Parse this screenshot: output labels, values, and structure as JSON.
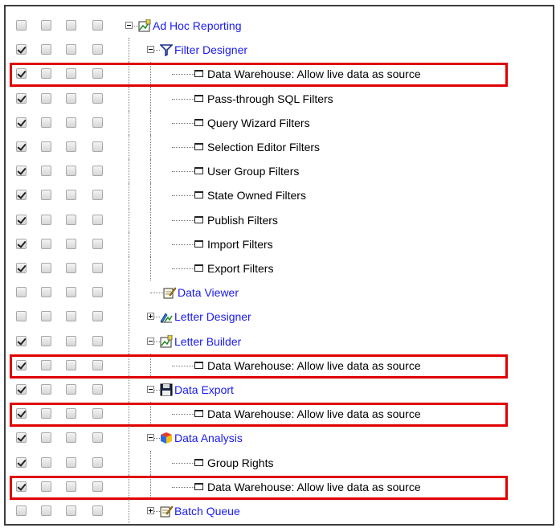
{
  "tree": {
    "rows": [
      {
        "label": "Ad Hoc Reporting",
        "checked": false,
        "level": 0,
        "expander": "minus",
        "icon": "ad-hoc-report-icon",
        "link": true
      },
      {
        "label": "Filter Designer",
        "checked": true,
        "level": 1,
        "expander": "minus",
        "icon": "filter-funnel-icon",
        "link": true
      },
      {
        "label": "Data Warehouse: Allow live data as source",
        "checked": true,
        "level": 2,
        "icon": "leaf-right-icon",
        "link": false,
        "highlighted": true
      },
      {
        "label": "Pass-through SQL Filters",
        "checked": true,
        "level": 2,
        "icon": "leaf-right-icon",
        "link": false
      },
      {
        "label": "Query Wizard Filters",
        "checked": true,
        "level": 2,
        "icon": "leaf-right-icon",
        "link": false
      },
      {
        "label": "Selection Editor Filters",
        "checked": true,
        "level": 2,
        "icon": "leaf-right-icon",
        "link": false
      },
      {
        "label": "User Group Filters",
        "checked": true,
        "level": 2,
        "icon": "leaf-right-icon",
        "link": false
      },
      {
        "label": "State Owned Filters",
        "checked": true,
        "level": 2,
        "icon": "leaf-right-icon",
        "link": false
      },
      {
        "label": "Publish Filters",
        "checked": true,
        "level": 2,
        "icon": "leaf-right-icon",
        "link": false
      },
      {
        "label": "Import Filters",
        "checked": true,
        "level": 2,
        "icon": "leaf-right-icon",
        "link": false
      },
      {
        "label": "Export Filters",
        "checked": true,
        "level": 2,
        "icon": "leaf-right-icon",
        "link": false
      },
      {
        "label": "Data Viewer",
        "checked": false,
        "level": 1,
        "icon": "data-viewer-notepad-icon",
        "link": true
      },
      {
        "label": "Letter Designer",
        "checked": false,
        "level": 1,
        "expander": "plus",
        "icon": "letter-designer-icon",
        "link": true
      },
      {
        "label": "Letter Builder",
        "checked": true,
        "level": 1,
        "expander": "minus",
        "icon": "letter-builder-icon",
        "link": true
      },
      {
        "label": "Data Warehouse: Allow live data as source",
        "checked": true,
        "level": 2,
        "icon": "leaf-right-icon",
        "link": false,
        "highlighted": true
      },
      {
        "label": "Data Export",
        "checked": true,
        "level": 1,
        "expander": "minus",
        "icon": "floppy-disk-icon",
        "link": true
      },
      {
        "label": "Data Warehouse: Allow live data as source",
        "checked": true,
        "level": 2,
        "icon": "leaf-right-icon",
        "link": false,
        "highlighted": true
      },
      {
        "label": "Data Analysis",
        "checked": true,
        "level": 1,
        "expander": "minus",
        "icon": "cube-icon",
        "link": true
      },
      {
        "label": "Group Rights",
        "checked": true,
        "level": 2,
        "icon": "leaf-right-icon",
        "link": false
      },
      {
        "label": "Data Warehouse: Allow live data as source",
        "checked": true,
        "level": 2,
        "icon": "leaf-right-icon",
        "link": false,
        "highlighted": true
      },
      {
        "label": "Batch Queue",
        "checked": false,
        "level": 1,
        "expander": "plus",
        "icon": "data-viewer-notepad-icon",
        "link": true
      }
    ]
  },
  "colors": {
    "highlight": "#e00000",
    "link": "#1a1af2",
    "frame": "#3c3c3c"
  }
}
